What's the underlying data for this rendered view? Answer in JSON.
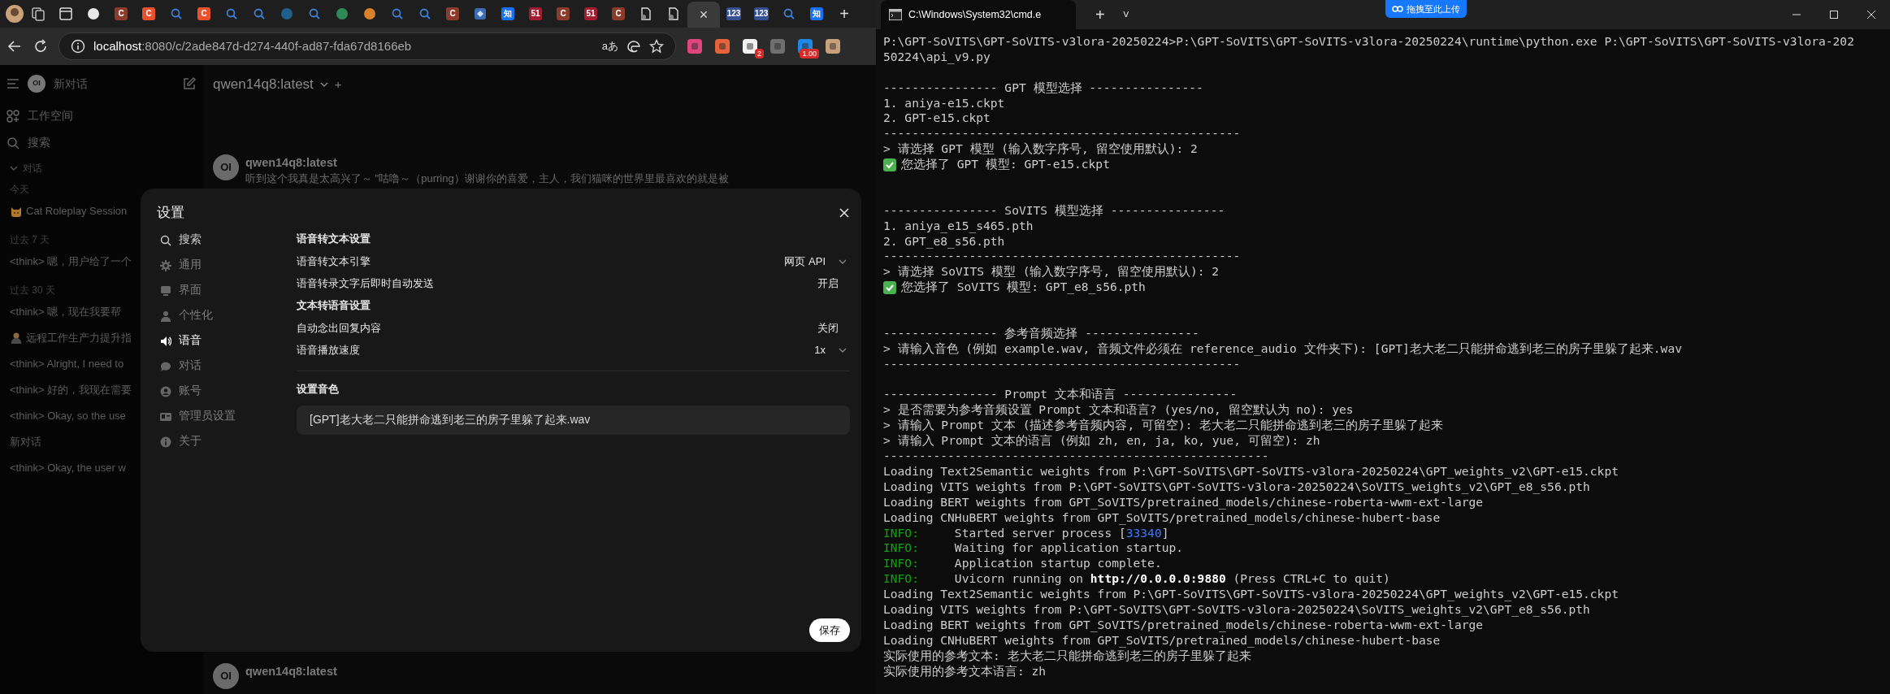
{
  "browser": {
    "tabs": [
      {
        "kind": "circle",
        "color": "#e8e8e8",
        "selected": false
      },
      {
        "kind": "letter",
        "glyph": "C",
        "color": "#8a3b2a",
        "selected": false
      },
      {
        "kind": "letter",
        "glyph": "C",
        "color": "#e8502e",
        "selected": false
      },
      {
        "kind": "search",
        "selected": false
      },
      {
        "kind": "letter",
        "glyph": "C",
        "color": "#e8502e",
        "selected": false
      },
      {
        "kind": "search",
        "selected": false
      },
      {
        "kind": "search",
        "selected": false
      },
      {
        "kind": "circle",
        "color": "#1f5f8b",
        "selected": false
      },
      {
        "kind": "search",
        "selected": false
      },
      {
        "kind": "circle",
        "color": "#2e8b57",
        "selected": false
      },
      {
        "kind": "circle",
        "color": "#d9822b",
        "selected": false
      },
      {
        "kind": "search",
        "selected": false
      },
      {
        "kind": "search",
        "selected": false
      },
      {
        "kind": "letter",
        "glyph": "C",
        "color": "#8a3b2a",
        "selected": false
      },
      {
        "kind": "square",
        "color": "#3d6bb3",
        "selected": false
      },
      {
        "kind": "letter",
        "glyph": "知",
        "color": "#1772f6",
        "selected": false
      },
      {
        "kind": "letter",
        "glyph": "51",
        "color": "#a01c2e",
        "selected": false
      },
      {
        "kind": "letter",
        "glyph": "C",
        "color": "#8a3b2a",
        "selected": false
      },
      {
        "kind": "letter",
        "glyph": "51",
        "color": "#a01c2e",
        "selected": false
      },
      {
        "kind": "letter",
        "glyph": "C",
        "color": "#8a3b2a",
        "selected": false
      },
      {
        "kind": "doc",
        "selected": false
      },
      {
        "kind": "doc",
        "selected": false
      },
      {
        "kind": "close",
        "close": "×",
        "selected": true
      },
      {
        "kind": "letter",
        "glyph": "123",
        "color": "#35508f",
        "selected": false
      },
      {
        "kind": "letter",
        "glyph": "123",
        "color": "#35508f",
        "selected": false
      },
      {
        "kind": "search",
        "selected": false
      },
      {
        "kind": "letter",
        "glyph": "知",
        "color": "#1772f6",
        "selected": false
      }
    ],
    "new_tab": "+",
    "url": "**localhost**:8080/c/2ade847d-d274-440f-ad87-fda67d8166eb",
    "read_aloud": "aあ",
    "extensions": [
      {
        "color": "#e0457b"
      },
      {
        "color": "#e8623a"
      },
      {
        "color": "#f2f2f2",
        "badge": "2"
      },
      {
        "color": "#6f6f6f"
      },
      {
        "color": "#1e88e5",
        "badge": "1.00"
      },
      {
        "color": "#c8a07a"
      }
    ]
  },
  "sidebar": {
    "logo": "OI",
    "new_chat": "新对话",
    "workspace": "工作空间",
    "search": "搜索",
    "section": {
      "label": "对话",
      "expanded": true
    },
    "groups": [
      {
        "label": "今天",
        "items": [
          {
            "title": "Cat Roleplay Session",
            "kind": "icon"
          }
        ]
      },
      {
        "label": "过去 7 天",
        "items": [
          {
            "title": "<think> 嗯，用户给了一个",
            "kind": "plain"
          }
        ]
      },
      {
        "label": "过去 30 天",
        "items": [
          {
            "title": "<think> 嗯，现在我要帮",
            "kind": "plain"
          },
          {
            "title": "远程工作生产力提升指",
            "kind": "icon"
          },
          {
            "title": "<think> Alright, I need to",
            "kind": "plain"
          },
          {
            "title": "<think> 好的，我现在需要",
            "kind": "plain"
          },
          {
            "title": "<think> Okay, so the use",
            "kind": "plain"
          },
          {
            "title": "新对话",
            "kind": "plain"
          },
          {
            "title": "<think> Okay, the user w",
            "kind": "plain"
          }
        ]
      }
    ]
  },
  "chat": {
    "model": "qwen14q8:latest",
    "add": "+",
    "messages": [
      {
        "avatar": "OI",
        "name": "qwen14q8:latest",
        "text": "听到这个我真是太高兴了～ \"咕噜～（purring）谢谢你的喜爱，主人，我们猫咪的世界里最喜欢的就是被"
      },
      {
        "avatar": "OI",
        "name": "qwen14q8:latest"
      }
    ]
  },
  "settings": {
    "title": "设置",
    "search": "搜索",
    "nav": [
      {
        "label": "通用",
        "selected": false
      },
      {
        "label": "界面",
        "selected": false
      },
      {
        "label": "个性化",
        "selected": false
      },
      {
        "label": "语音",
        "selected": true
      },
      {
        "label": "对话",
        "selected": false
      },
      {
        "label": "账号",
        "selected": false
      },
      {
        "label": "管理员设置",
        "selected": false
      },
      {
        "label": "关于",
        "selected": false
      }
    ],
    "sections": [
      {
        "title": "语音转文本设置",
        "rows": [
          {
            "label": "语音转文本引擎",
            "value": "网页 API",
            "kind": "select"
          },
          {
            "label": "语音转录文字后即时自动发送",
            "value": "开启",
            "kind": "toggle"
          }
        ]
      },
      {
        "title": "文本转语音设置",
        "rows": [
          {
            "label": "自动念出回复内容",
            "value": "关闭",
            "kind": "toggle"
          },
          {
            "label": "语音播放速度",
            "value": "1x",
            "kind": "select"
          }
        ]
      }
    ],
    "voice": {
      "title": "设置音色",
      "value": "[GPT]老大老二只能拼命逃到老三的房子里躲了起来.wav"
    },
    "save": "保存"
  },
  "terminal": {
    "tab": "C:\\Windows\\System32\\cmd.e",
    "new_tab": "+",
    "dropdown": "˅",
    "upload": "拖拽至此上传",
    "lines": [
      {
        "kind": "text",
        "text": "P:\\GPT-SoVITS\\GPT-SoVITS-v3lora-20250224>P:\\GPT-SoVITS\\GPT-SoVITS-v3lora-20250224\\runtime\\python.exe P:\\GPT-SoVITS\\GPT-SoVITS-v3lora-202"
      },
      {
        "kind": "text",
        "text": "50224\\api_v9.py"
      },
      {
        "kind": "blank"
      },
      {
        "kind": "text",
        "text": "---------------- GPT 模型选择 ----------------"
      },
      {
        "kind": "text",
        "text": "1. aniya-e15.ckpt"
      },
      {
        "kind": "text",
        "text": "2. GPT-e15.ckpt"
      },
      {
        "kind": "text",
        "text": "--------------------------------------------------"
      },
      {
        "kind": "text",
        "text": "> 请选择 GPT 模型 (输入数字序号, 留空使用默认): 2"
      },
      {
        "kind": "check",
        "text": "您选择了 GPT 模型: GPT-e15.ckpt"
      },
      {
        "kind": "blank"
      },
      {
        "kind": "blank"
      },
      {
        "kind": "text",
        "text": "---------------- SoVITS 模型选择 ----------------"
      },
      {
        "kind": "text",
        "text": "1. aniya_e15_s465.pth"
      },
      {
        "kind": "text",
        "text": "2. GPT_e8_s56.pth"
      },
      {
        "kind": "text",
        "text": "--------------------------------------------------"
      },
      {
        "kind": "text",
        "text": "> 请选择 SoVITS 模型 (输入数字序号, 留空使用默认): 2"
      },
      {
        "kind": "check",
        "text": "您选择了 SoVITS 模型: GPT_e8_s56.pth"
      },
      {
        "kind": "blank"
      },
      {
        "kind": "blank"
      },
      {
        "kind": "text",
        "text": "---------------- 参考音频选择 ----------------"
      },
      {
        "kind": "text",
        "text": "> 请输入音色 (例如 example.wav, 音频文件必须在 reference_audio 文件夹下): [GPT]老大老二只能拼命逃到老三的房子里躲了起来.wav"
      },
      {
        "kind": "text",
        "text": "--------------------------------------------------"
      },
      {
        "kind": "blank"
      },
      {
        "kind": "text",
        "text": "---------------- Prompt 文本和语言 ----------------"
      },
      {
        "kind": "text",
        "text": "> 是否需要为参考音频设置 Prompt 文本和语言? (yes/no, 留空默认为 no): yes"
      },
      {
        "kind": "text",
        "text": "> 请输入 Prompt 文本 (描述参考音频内容, 可留空): 老大老二只能拼命逃到老三的房子里躲了起来"
      },
      {
        "kind": "text",
        "text": "> 请输入 Prompt 文本的语言 (例如 zh, en, ja, ko, yue, 可留空): zh"
      },
      {
        "kind": "text",
        "text": "------------------------------------------------------"
      },
      {
        "kind": "text",
        "text": "Loading Text2Semantic weights from P:\\GPT-SoVITS\\GPT-SoVITS-v3lora-20250224\\GPT_weights_v2\\GPT-e15.ckpt"
      },
      {
        "kind": "text",
        "text": "Loading VITS weights from P:\\GPT-SoVITS\\GPT-SoVITS-v3lora-20250224\\SoVITS_weights_v2\\GPT_e8_s56.pth"
      },
      {
        "kind": "text",
        "text": "Loading BERT weights from GPT_SoVITS/pretrained_models/chinese-roberta-wwm-ext-large"
      },
      {
        "kind": "text",
        "text": "Loading CNHuBERT weights from GPT_SoVITS/pretrained_models/chinese-hubert-base"
      },
      {
        "kind": "text",
        "segments": [
          {
            "text": "INFO:",
            "kind": "info"
          },
          {
            "text": "     Started server process [",
            "kind": "plain"
          },
          {
            "text": "33340",
            "kind": "number"
          },
          {
            "text": "]",
            "kind": "plain"
          }
        ]
      },
      {
        "kind": "text",
        "segments": [
          {
            "text": "INFO:",
            "kind": "info"
          },
          {
            "text": "     Waiting for application startup.",
            "kind": "plain"
          }
        ]
      },
      {
        "kind": "text",
        "segments": [
          {
            "text": "INFO:",
            "kind": "info"
          },
          {
            "text": "     Application startup complete.",
            "kind": "plain"
          }
        ]
      },
      {
        "kind": "text",
        "segments": [
          {
            "text": "INFO:",
            "kind": "info"
          },
          {
            "text": "     Uvicorn running on ",
            "kind": "plain"
          },
          {
            "text": "http://0.0.0.0:9880",
            "kind": "bold"
          },
          {
            "text": " (Press CTRL+C to quit)",
            "kind": "plain"
          }
        ]
      },
      {
        "kind": "text",
        "text": "Loading Text2Semantic weights from P:\\GPT-SoVITS\\GPT-SoVITS-v3lora-20250224\\GPT_weights_v2\\GPT-e15.ckpt"
      },
      {
        "kind": "text",
        "text": "Loading VITS weights from P:\\GPT-SoVITS\\GPT-SoVITS-v3lora-20250224\\SoVITS_weights_v2\\GPT_e8_s56.pth"
      },
      {
        "kind": "text",
        "text": "Loading BERT weights from GPT_SoVITS/pretrained_models/chinese-roberta-wwm-ext-large"
      },
      {
        "kind": "text",
        "text": "Loading CNHuBERT weights from GPT_SoVITS/pretrained_models/chinese-hubert-base"
      },
      {
        "kind": "text",
        "text": "实际使用的参考文本: 老大老二只能拼命逃到老三的房子里躲了起来"
      },
      {
        "kind": "text",
        "text": "实际使用的参考文本语言: zh"
      }
    ]
  }
}
